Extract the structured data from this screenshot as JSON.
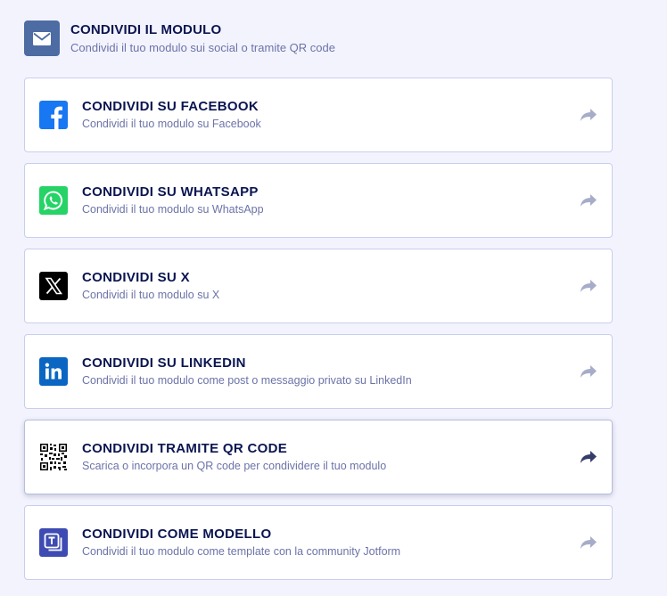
{
  "header": {
    "title": "CONDIVIDI IL MODULO",
    "subtitle": "Condividi il tuo modulo sui social o tramite QR code",
    "icon": "envelope-icon"
  },
  "options": [
    {
      "title": "CONDIVIDI SU FACEBOOK",
      "subtitle": "Condividi il tuo modulo su Facebook",
      "icon": "facebook-icon",
      "color": "#1877f2"
    },
    {
      "title": "CONDIVIDI SU WHATSAPP",
      "subtitle": "Condividi il tuo modulo su WhatsApp",
      "icon": "whatsapp-icon",
      "color": "#25d366"
    },
    {
      "title": "CONDIVIDI SU X",
      "subtitle": "Condividi il tuo modulo su X",
      "icon": "x-icon",
      "color": "#000000"
    },
    {
      "title": "CONDIVIDI SU LINKEDIN",
      "subtitle": "Condividi il tuo modulo come post o messaggio privato su LinkedIn",
      "icon": "linkedin-icon",
      "color": "#0a66c2"
    },
    {
      "title": "CONDIVIDI TRAMITE QR CODE",
      "subtitle": "Scarica o incorpora un QR code per condividere il tuo modulo",
      "icon": "qr-code-icon",
      "color": "#000000"
    },
    {
      "title": "CONDIVIDI COME MODELLO",
      "subtitle": "Condividi il tuo modulo come template con la community Jotform",
      "icon": "template-icon",
      "color": "#3e4bb3"
    }
  ],
  "colors": {
    "background": "#f3f3fe",
    "title": "#0a1551",
    "subtitle": "#6c73a8",
    "arrow": "#a7acc9",
    "arrow_active": "#343c6a"
  }
}
